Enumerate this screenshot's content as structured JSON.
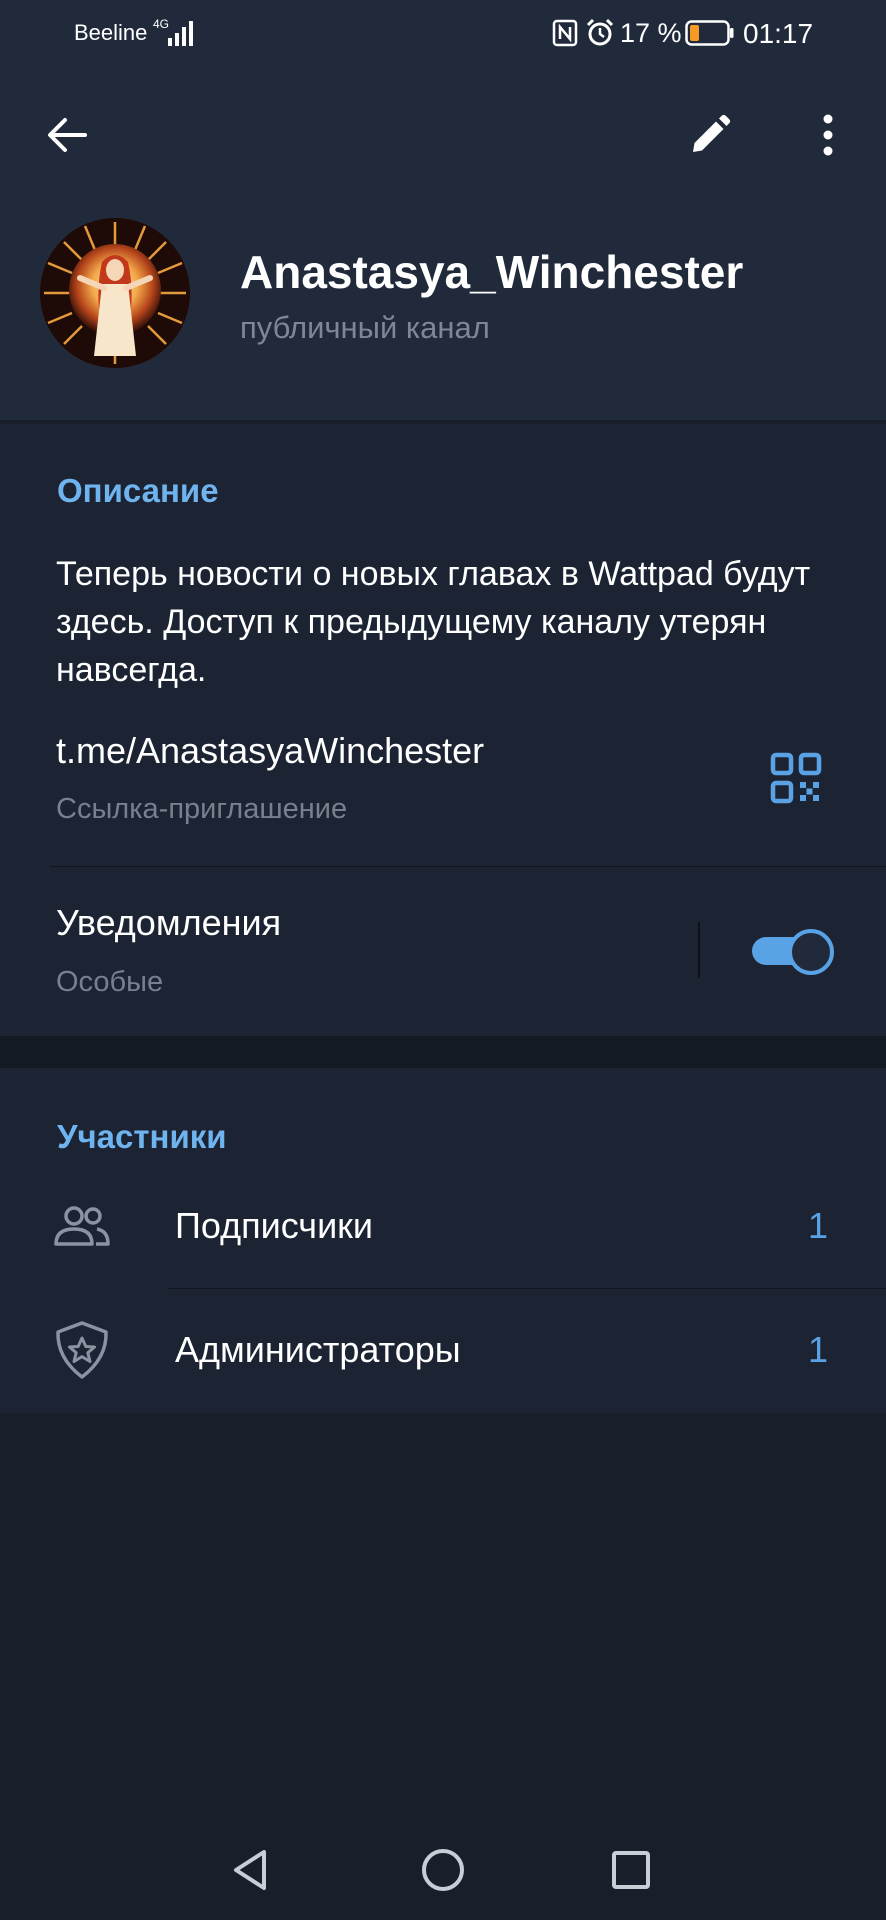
{
  "status_bar": {
    "carrier": "Beeline",
    "network": "4G",
    "battery_percent": "17 %",
    "time": "01:17"
  },
  "icons": {
    "back": "arrow-left",
    "edit": "pencil",
    "more": "vertical-dots",
    "qr": "qr-code",
    "subscribers": "people",
    "admins": "shield-star"
  },
  "channel": {
    "name": "Anastasya_Winchester",
    "type": "публичный канал"
  },
  "info": {
    "description_header": "Описание",
    "description": "Теперь новости о новых главах в Wattpad будут здесь. Доступ к предыдущему каналу утерян навсегда.",
    "link": "t.me/AnastasyaWinchester",
    "link_label": "Ссылка-приглашение",
    "notifications_label": "Уведомления",
    "notifications_value": "Особые",
    "notifications_on": true
  },
  "members": {
    "header": "Участники",
    "rows": [
      {
        "label": "Подписчики",
        "count": "1"
      },
      {
        "label": "Администраторы",
        "count": "1"
      }
    ]
  },
  "colors": {
    "accent": "#6fb3ef",
    "toggle": "#5aa2e6",
    "header_bg": "#212a3b",
    "section_bg": "#1c2433",
    "page_bg": "#181f2b"
  }
}
